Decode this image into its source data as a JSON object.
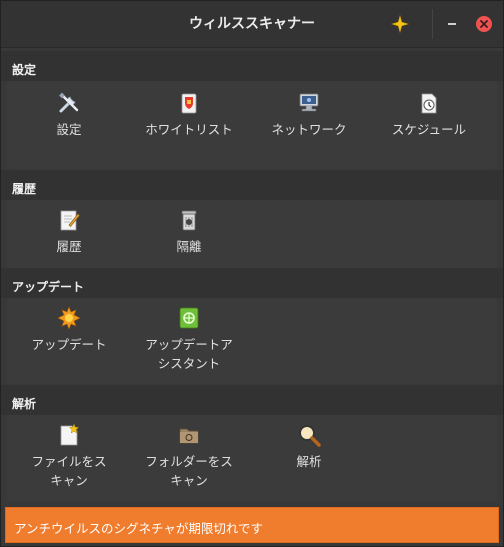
{
  "window": {
    "title": "ウィルススキャナー"
  },
  "sections": [
    {
      "title": "設定",
      "items": [
        {
          "label": "設定",
          "icon": "tools-icon"
        },
        {
          "label": "ホワイトリスト",
          "icon": "whitelist-icon"
        },
        {
          "label": "ネットワーク",
          "icon": "network-icon"
        },
        {
          "label": "スケジュール",
          "icon": "schedule-icon"
        }
      ]
    },
    {
      "title": "履歴",
      "items": [
        {
          "label": "履歴",
          "icon": "history-icon"
        },
        {
          "label": "隔離",
          "icon": "quarantine-icon"
        }
      ]
    },
    {
      "title": "アップデート",
      "items": [
        {
          "label": "アップデート",
          "icon": "update-icon"
        },
        {
          "label": "アップデートア\nシスタント",
          "icon": "update-assistant-icon"
        }
      ]
    },
    {
      "title": "解析",
      "items": [
        {
          "label": "ファイルをス\nキャン",
          "icon": "scan-file-icon"
        },
        {
          "label": "フォルダーをス\nキャン",
          "icon": "scan-folder-icon"
        },
        {
          "label": "解析",
          "icon": "analysis-icon"
        }
      ]
    }
  ],
  "status": {
    "message": "アンチウイルスのシグネチャが期限切れです"
  },
  "colors": {
    "status_bg": "#f07c2e",
    "close": "#ef5350",
    "accent_star": "#f5c518"
  }
}
